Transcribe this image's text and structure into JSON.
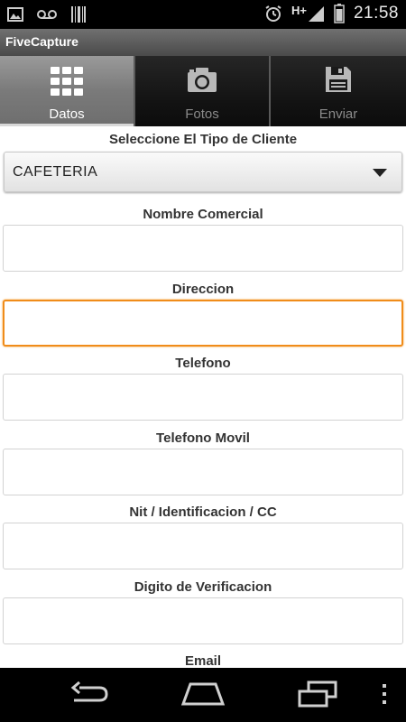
{
  "status_bar": {
    "network": "H+",
    "time": "21:58"
  },
  "app": {
    "title": "FiveCapture"
  },
  "tabs": [
    {
      "label": "Datos",
      "icon": "grid-icon",
      "active": true
    },
    {
      "label": "Fotos",
      "icon": "camera-icon",
      "active": false
    },
    {
      "label": "Enviar",
      "icon": "save-icon",
      "active": false
    }
  ],
  "form": {
    "client_type": {
      "label": "Seleccione El Tipo de Cliente",
      "selected": "CAFETERIA"
    },
    "fields": [
      {
        "label": "Nombre Comercial",
        "value": ""
      },
      {
        "label": "Direccion",
        "value": ""
      },
      {
        "label": "Telefono",
        "value": ""
      },
      {
        "label": "Telefono Movil",
        "value": ""
      },
      {
        "label": "Nit / Identificacion / CC",
        "value": ""
      },
      {
        "label": "Digito de Verificacion",
        "value": ""
      },
      {
        "label": "Email",
        "value": ""
      }
    ]
  },
  "nav_bar": {
    "buttons": [
      "back-icon",
      "home-icon",
      "recent-apps-icon",
      "overflow-menu-icon"
    ]
  },
  "colors": {
    "focus_border": "#f08c1a",
    "active_tab": "#8a8a8a",
    "inactive_tab": "#141414"
  }
}
